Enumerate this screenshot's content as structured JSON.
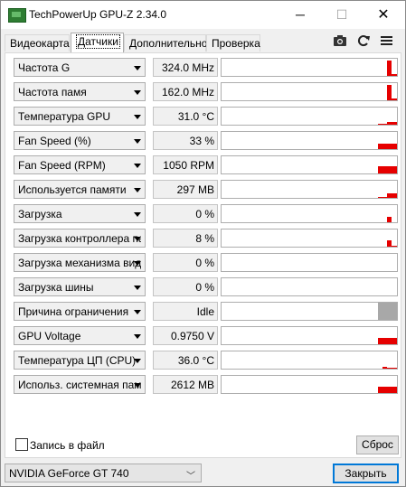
{
  "window": {
    "title": "TechPowerUp GPU-Z 2.34.0",
    "minimize": "─",
    "maximize": "☐",
    "close": "✕"
  },
  "tabs": [
    {
      "label": "Видеокарта",
      "active": false
    },
    {
      "label": "Датчики",
      "active": true
    },
    {
      "label": "Дополнительно",
      "active": false
    },
    {
      "label": "Проверка",
      "active": false
    }
  ],
  "toolbar": {
    "icons": [
      "camera-icon",
      "refresh-icon",
      "menu-icon"
    ]
  },
  "sensors": [
    {
      "name": "Частота G",
      "value": "324.0 MHz",
      "graph": [
        0.0,
        0.0,
        0.9,
        0.1,
        0.1
      ]
    },
    {
      "name": "Частота памя",
      "value": "162.0 MHz",
      "graph": [
        0.0,
        0.0,
        0.9,
        0.1,
        0.1
      ]
    },
    {
      "name": "Температура GPU",
      "value": "31.0 °C",
      "graph": [
        0.05,
        0.05,
        0.15,
        0.15,
        0.15
      ]
    },
    {
      "name": "Fan Speed (%)",
      "value": "33 %",
      "graph": [
        0.3,
        0.3,
        0.3,
        0.3,
        0.3
      ]
    },
    {
      "name": "Fan Speed (RPM)",
      "value": "1050 RPM",
      "graph": [
        0.4,
        0.4,
        0.4,
        0.4,
        0.4
      ]
    },
    {
      "name": "Используется памяти",
      "value": "297 MB",
      "graph": [
        0.05,
        0.05,
        0.25,
        0.25,
        0.25
      ]
    },
    {
      "name": "Загрузка",
      "value": "0 %",
      "graph": [
        0.0,
        0.0,
        0.3,
        0.0,
        0.0
      ]
    },
    {
      "name": "Загрузка контроллера памяти",
      "value": "8 %",
      "graph": [
        0.0,
        0.0,
        0.35,
        0.05,
        0.05
      ]
    },
    {
      "name": "Загрузка механизма видео",
      "value": "0 %",
      "graph": [
        0,
        0,
        0,
        0,
        0
      ]
    },
    {
      "name": "Загрузка шины",
      "value": "0 %",
      "graph": [
        0,
        0,
        0,
        0,
        0
      ]
    },
    {
      "name": "Причина ограничения",
      "value": "Idle",
      "graph": [
        0,
        0,
        0,
        0,
        0
      ],
      "status_block": true
    },
    {
      "name": "GPU Voltage",
      "value": "0.9750 V",
      "graph": [
        0.35,
        0.35,
        0.35,
        0.35,
        0.35
      ]
    },
    {
      "name": "Температура ЦП (CPU)",
      "value": "36.0 °C",
      "graph": [
        0.0,
        0.1,
        0.05,
        0.05,
        0.05
      ]
    },
    {
      "name": "Использ. системная память",
      "value": "2612 MB",
      "graph": [
        0.35,
        0.35,
        0.35,
        0.35,
        0.35
      ]
    }
  ],
  "footer": {
    "log_label": "Запись в файл",
    "log_checked": false,
    "reset_label": "Сброс",
    "gpu_selected": "NVIDIA GeForce GT 740",
    "close_label": "Закрыть"
  },
  "colors": {
    "graph": "#e60000",
    "idle_block": "#a8a8a8",
    "accent": "#0078d7"
  }
}
